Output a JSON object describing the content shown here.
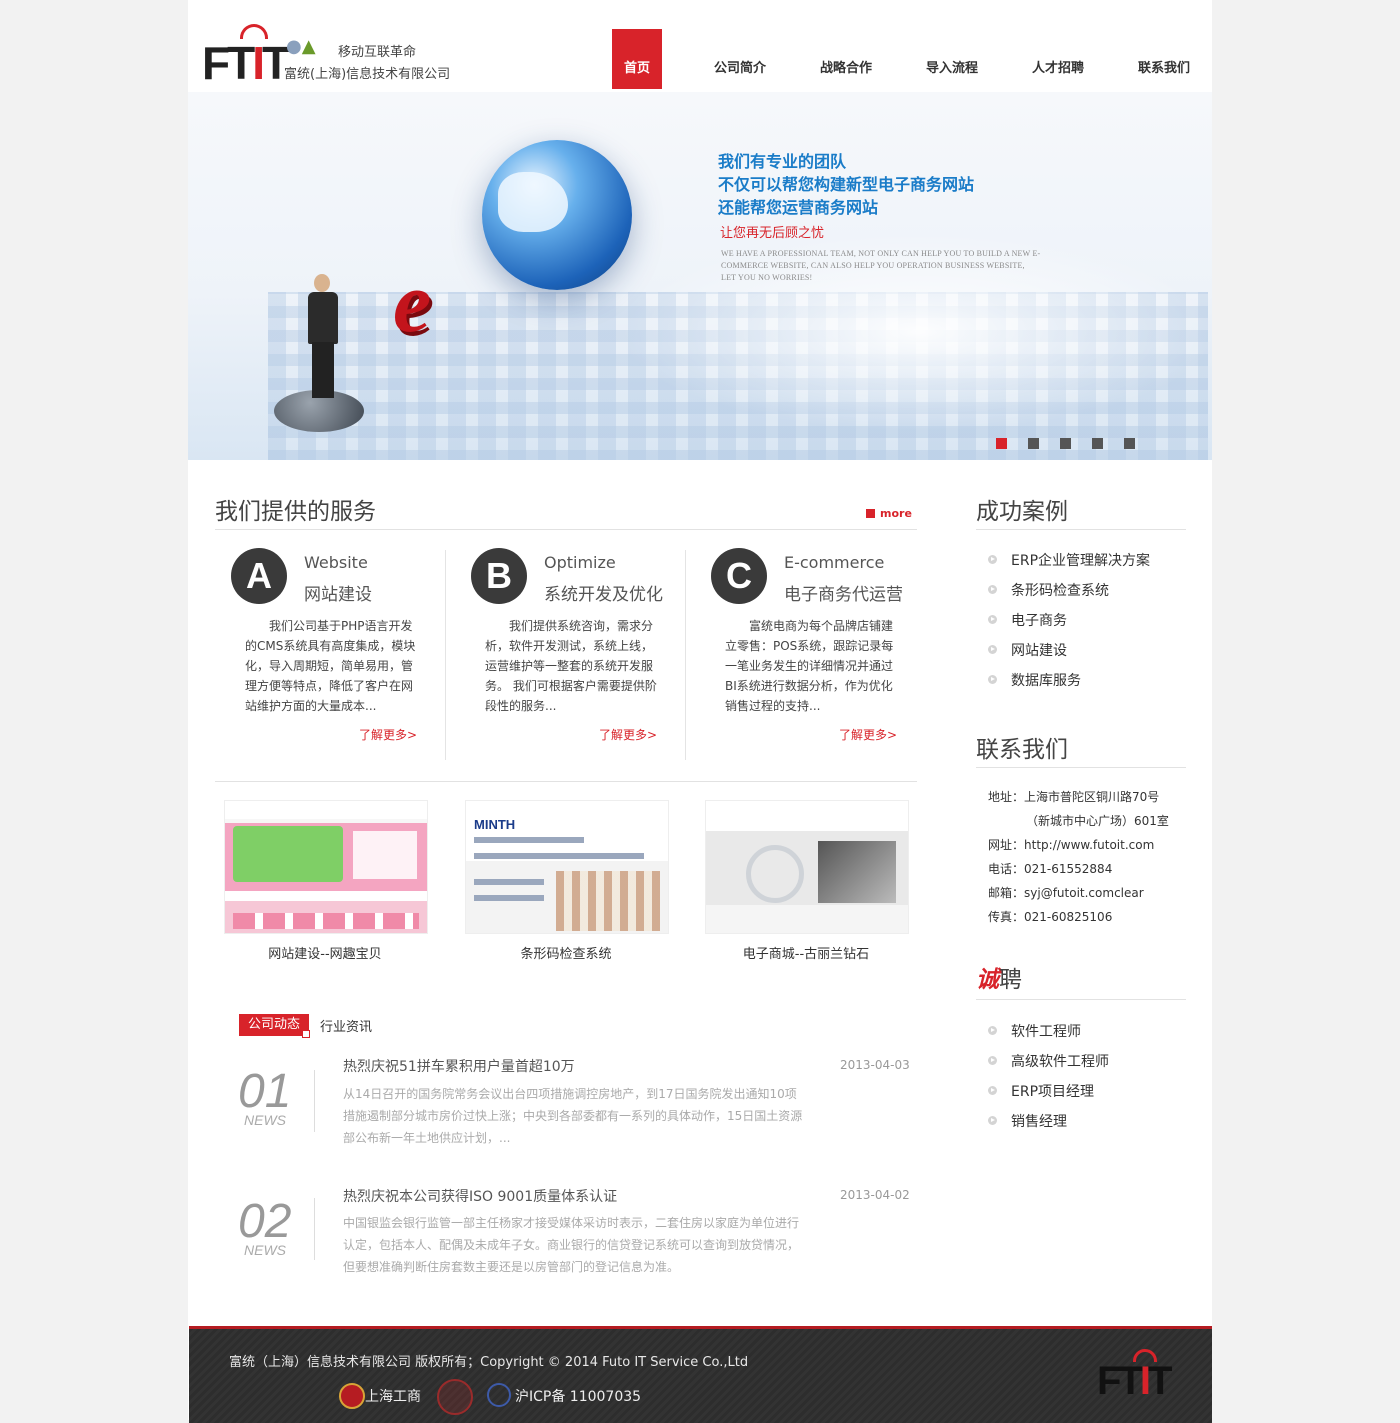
{
  "header": {
    "logo_text": "FTIT",
    "slogan": "移动互联革命",
    "company": "富统(上海)信息技术有限公司"
  },
  "nav": [
    {
      "label": "首页",
      "active": true
    },
    {
      "label": "公司简介"
    },
    {
      "label": "战略合作"
    },
    {
      "label": "导入流程"
    },
    {
      "label": "人才招聘"
    },
    {
      "label": "联系我们"
    }
  ],
  "banner": {
    "lines": [
      "我们有专业的团队",
      "不仅可以帮您构建新型电子商务网站",
      "还能帮您运营商务网站"
    ],
    "red_line": "让您再无后顾之忧",
    "english": "WE HAVE A PROFESSIONAL TEAM, NOT ONLY CAN HELP YOU TO BUILD A NEW E-COMMERCE WEBSITE, CAN ALSO HELP YOU OPERATION BUSINESS WEBSITE, LET YOU NO WORRIES!",
    "slide_count": 5,
    "active_slide": 1
  },
  "services": {
    "title": "我们提供的服务",
    "more": "more",
    "items": [
      {
        "letter": "A",
        "en": "Website",
        "cn": "网站建设",
        "desc": "我们公司基于PHP语言开发的CMS系统具有高度集成，模块化，导入周期短，简单易用，管理方便等特点，降低了客户在网站维护方面的大量成本...",
        "more": "了解更多>"
      },
      {
        "letter": "B",
        "en": "Optimize",
        "cn": "系统开发及优化",
        "desc": "我们提供系统咨询，需求分析，软件开发测试，系统上线，运营维护等一整套的系统开发服务。 我们可根据客户需要提供阶段性的服务...",
        "more": "了解更多>"
      },
      {
        "letter": "C",
        "en": "E-commerce",
        "cn": "电子商务代运营",
        "desc": "富统电商为每个品牌店铺建立零售：POS系统，跟踪记录每一笔业务发生的详细情况并通过BI系统进行数据分析，作为优化销售过程的支持...",
        "more": "了解更多>"
      }
    ]
  },
  "cases_row": [
    {
      "caption": "网站建设--网趣宝贝",
      "logo": "网趣宝贝"
    },
    {
      "caption": "条形码检查系统",
      "logo": "MINTH"
    },
    {
      "caption": "电子商城--古丽兰钻石",
      "logo": "古丽兰"
    }
  ],
  "news": {
    "tab_active": "公司动态",
    "tab_other": "行业资讯",
    "items": [
      {
        "num": "01",
        "label": "NEWS",
        "title": "热烈庆祝51拼车累积用户量首超10万",
        "date": "2013-04-03",
        "body": "从14日召开的国务院常务会议出台四项措施调控房地产，到17日国务院发出通知10项措施遏制部分城市房价过快上涨；中央到各部委都有一系列的具体动作，15日国土资源部公布新一年土地供应计划，..."
      },
      {
        "num": "02",
        "label": "NEWS",
        "title": "热烈庆祝本公司获得ISO 9001质量体系认证",
        "date": "2013-04-02",
        "body": "中国银监会银行监管一部主任杨家才接受媒体采访时表示，二套住房以家庭为单位进行认定，包括本人、配偶及未成年子女。商业银行的信贷登记系统可以查询到放贷情况，但要想准确判断住房套数主要还是以房管部门的登记信息为准。"
      }
    ]
  },
  "sidebar": {
    "cases_title": "成功案例",
    "cases": [
      "ERP企业管理解决方案",
      "条形码检查系统",
      "电子商务",
      "网站建设",
      "数据库服务"
    ],
    "contact_title": "联系我们",
    "contact": [
      {
        "label": "地址：",
        "value": "上海市普陀区铜川路70号"
      },
      {
        "label": "",
        "value": "（新城市中心广场）601室"
      },
      {
        "label": "网址：",
        "value": "http://www.futoit.com"
      },
      {
        "label": "电话：",
        "value": "021-61552884"
      },
      {
        "label": "邮箱：",
        "value": "syj@futoit.comclear"
      },
      {
        "label": "传真：",
        "value": "021-60825106"
      }
    ],
    "recruit_title_red": "诚",
    "recruit_title_rest": "聘",
    "jobs": [
      "软件工程师",
      "高级软件工程师",
      "ERP项目经理",
      "销售经理"
    ]
  },
  "footer": {
    "copyright": "富统（上海）信息技术有限公司 版权所有；Copyright © 2014 Futo IT Service Co.,Ltd",
    "badge1": "上海工商",
    "badge2": "沪ICP备 11007035",
    "logo_text": "FTIT"
  },
  "colors": {
    "accent": "#d8232a",
    "banner_text": "#1a7cc8",
    "footer_bg": "#2d2d2d"
  }
}
